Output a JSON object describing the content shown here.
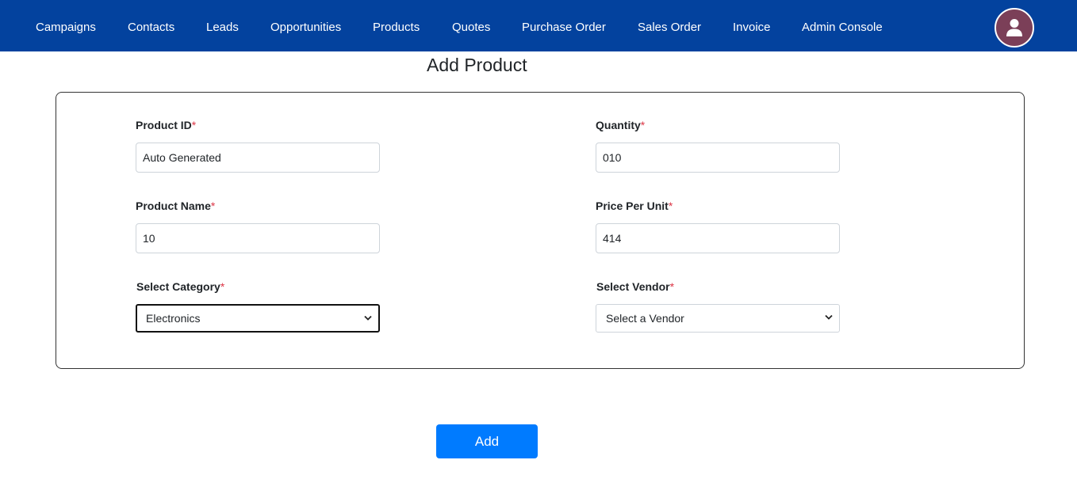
{
  "nav": {
    "items": [
      {
        "label": "Campaigns"
      },
      {
        "label": "Contacts"
      },
      {
        "label": "Leads"
      },
      {
        "label": "Opportunities"
      },
      {
        "label": "Products"
      },
      {
        "label": "Quotes"
      },
      {
        "label": "Purchase Order"
      },
      {
        "label": "Sales Order"
      },
      {
        "label": "Invoice"
      },
      {
        "label": "Admin Console"
      }
    ],
    "avatar_icon": "user-icon",
    "colors": {
      "bar": "#03429e",
      "avatar": "#7b3f58"
    }
  },
  "page": {
    "title": "Add Product"
  },
  "form": {
    "required_marker": "*",
    "product_id": {
      "label": "Product ID",
      "value": "Auto Generated"
    },
    "quantity": {
      "label": "Quantity",
      "value": "010"
    },
    "product_name": {
      "label": "Product Name",
      "value": "10"
    },
    "price_per_unit": {
      "label": "Price Per Unit",
      "value": "414"
    },
    "category": {
      "label": "Select Category",
      "selected": "Electronics"
    },
    "vendor": {
      "label": "Select Vendor",
      "selected": "Select a Vendor"
    },
    "submit_label": "Add"
  },
  "colors": {
    "required": "#dc3545",
    "button": "#007bff"
  }
}
